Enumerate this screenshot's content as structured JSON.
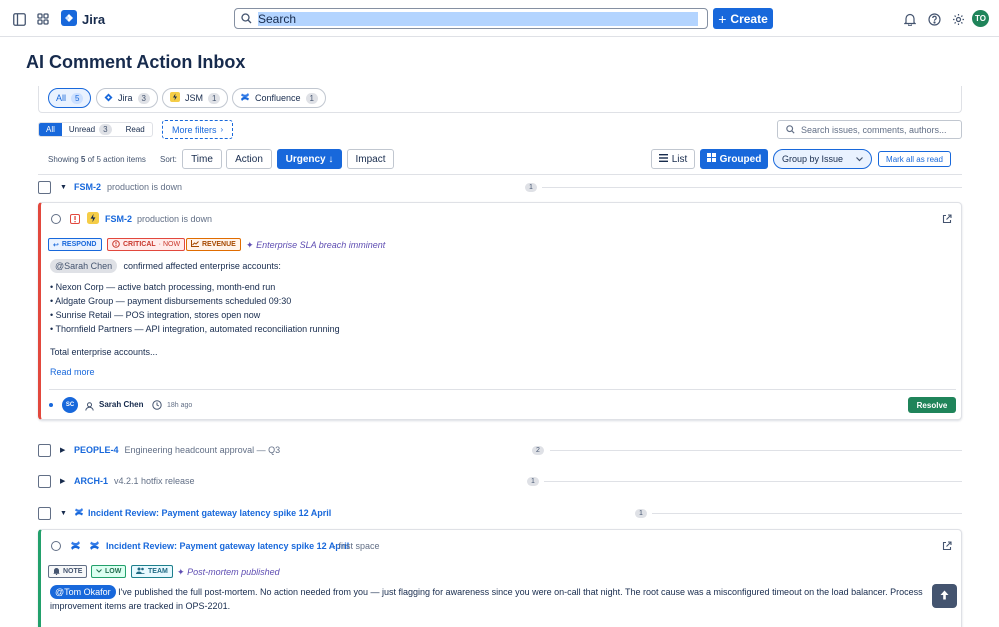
{
  "topnav": {
    "app_name": "Jira",
    "search_placeholder": "Search",
    "create_label": "Create",
    "avatar_initials": "TO"
  },
  "page": {
    "title": "AI Comment Action Inbox"
  },
  "source_filters": [
    {
      "label": "All",
      "count": "5",
      "active": true
    },
    {
      "label": "Jira",
      "count": "3"
    },
    {
      "label": "JSM",
      "count": "1"
    },
    {
      "label": "Confluence",
      "count": "1"
    }
  ],
  "read_filter": [
    {
      "label": "All",
      "active": true
    },
    {
      "label": "Unread",
      "count": "3"
    },
    {
      "label": "Read"
    }
  ],
  "more_filters_label": "More filters",
  "search_filter_placeholder": "Search issues, comments, authors...",
  "toolbar": {
    "showing_prefix": "Showing",
    "showing_count": "5",
    "showing_suffix": "of 5 action items",
    "sort_label": "Sort:",
    "sort_time": "Time",
    "sort_action": "Action",
    "sort_urgency": "Urgency ↓",
    "sort_impact": "Impact",
    "view_list": "List",
    "view_grouped": "Grouped",
    "group_by": "Group by Issue",
    "mark_all_read": "Mark all as read"
  },
  "groups": [
    {
      "key": "FSM-2",
      "title": "production is down",
      "count": "1",
      "expanded": true
    },
    {
      "key": "PEOPLE-4",
      "title": "Engineering headcount approval — Q3",
      "count": "2",
      "expanded": false
    },
    {
      "key": "ARCH-1",
      "title": "v4.2.1 hotfix release",
      "count": "1",
      "expanded": false
    },
    {
      "key": "",
      "title": "Incident Review: Payment gateway latency spike 12 April",
      "count": "1",
      "expanded": true
    }
  ],
  "card1": {
    "key": "FSM-2",
    "title": "production is down",
    "tags": {
      "action": "RESPOND",
      "urgency": "CRITICAL",
      "urgency_note": "· NOW",
      "impact": "REVENUE"
    },
    "ai_note": "Enterprise SLA breach imminent",
    "mention": "@Sarah Chen",
    "intro": "confirmed affected enterprise accounts:",
    "bullets": [
      "• Nexon Corp — active batch processing, month-end run",
      "• Aldgate Group — payment disbursements scheduled 09:30",
      "• Sunrise Retail — POS integration, stores open now",
      "• Thornfield Partners — API integration, automated reconciliation running"
    ],
    "tail": "Total enterprise accounts...",
    "read_more": "Read more",
    "author_initials": "SC",
    "author": "Sarah Chen",
    "time": "18h ago",
    "resolve": "Resolve",
    "accent": "#e2483d"
  },
  "card2": {
    "title": "Incident Review: Payment gateway latency spike 12 April",
    "space": "· first space",
    "tags": {
      "action": "NOTE",
      "urgency": "LOW",
      "impact": "TEAM"
    },
    "ai_note": "Post-mortem published",
    "mention": "@Tom Okafor",
    "text": "I've published the full post-mortem. No action needed from you — just flagging for awareness since you were on-call that night. The root cause was a misconfigured timeout on the load balancer. Process improvement items are tracked in OPS-2201.",
    "accent": "#22a06b"
  }
}
